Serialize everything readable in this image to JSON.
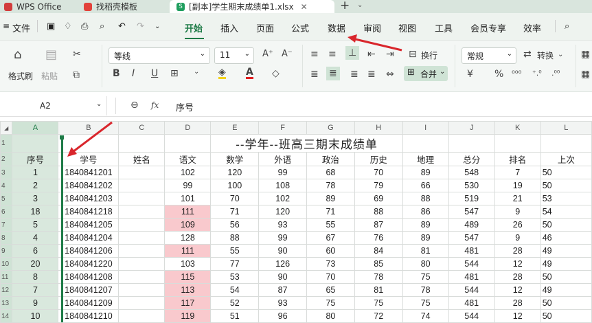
{
  "tabs": [
    {
      "label": "WPS Office",
      "color": "#d23c3c"
    },
    {
      "label": "找稻壳模板",
      "color": "#e2423b"
    },
    {
      "label": "[副本]学生期末成绩单1.xlsx",
      "color": "#1e9e5e",
      "icon_text": "S"
    }
  ],
  "tabbar": {
    "plus": "+",
    "chev": "⌄"
  },
  "menu": {
    "file": "文件",
    "items": [
      "开始",
      "插入",
      "页面",
      "公式",
      "数据",
      "审阅",
      "视图",
      "工具",
      "会员专享",
      "效率"
    ],
    "active": "开始"
  },
  "ribbon": {
    "format_painter": "格式刷",
    "paste": "粘贴",
    "font_name": "等线",
    "font_size": "11",
    "wrap": "换行",
    "merge": "合并",
    "number_format": "常规",
    "convert": "转换",
    "bold": "B",
    "italic": "I",
    "underline": "U",
    "font_color_letter": "A"
  },
  "formula_bar": {
    "cell_ref": "A2",
    "fx": "fx",
    "value": "序号"
  },
  "sheet": {
    "col_headers": [
      "A",
      "B",
      "C",
      "D",
      "E",
      "F",
      "G",
      "H",
      "I",
      "J",
      "K",
      "L"
    ],
    "title": "--学年--班高三期末成绩单",
    "headers": [
      "序号",
      "学号",
      "姓名",
      "语文",
      "数学",
      "外语",
      "政治",
      "历史",
      "地理",
      "总分",
      "排名",
      "上次"
    ],
    "rows": [
      [
        "1",
        "1840841201",
        "",
        "102",
        "120",
        "99",
        "68",
        "70",
        "89",
        "548",
        "7",
        "50"
      ],
      [
        "2",
        "1840841202",
        "",
        "99",
        "100",
        "108",
        "78",
        "79",
        "66",
        "530",
        "19",
        "50"
      ],
      [
        "3",
        "1840841203",
        "",
        "101",
        "70",
        "102",
        "89",
        "69",
        "88",
        "519",
        "21",
        "53"
      ],
      [
        "18",
        "1840841218",
        "",
        "111",
        "71",
        "120",
        "71",
        "88",
        "86",
        "547",
        "9",
        "54"
      ],
      [
        "5",
        "1840841205",
        "",
        "109",
        "56",
        "93",
        "55",
        "87",
        "89",
        "489",
        "26",
        "50"
      ],
      [
        "4",
        "1840841204",
        "",
        "128",
        "88",
        "99",
        "67",
        "76",
        "89",
        "547",
        "9",
        "46"
      ],
      [
        "6",
        "1840841206",
        "",
        "111",
        "55",
        "90",
        "60",
        "84",
        "81",
        "481",
        "28",
        "49"
      ],
      [
        "20",
        "1840841220",
        "",
        "103",
        "77",
        "126",
        "73",
        "85",
        "80",
        "544",
        "12",
        "49"
      ],
      [
        "8",
        "1840841208",
        "",
        "115",
        "53",
        "90",
        "70",
        "78",
        "75",
        "481",
        "28",
        "50"
      ],
      [
        "7",
        "1840841207",
        "",
        "113",
        "54",
        "87",
        "65",
        "81",
        "78",
        "544",
        "12",
        "49"
      ],
      [
        "9",
        "1840841209",
        "",
        "117",
        "52",
        "93",
        "75",
        "75",
        "75",
        "481",
        "28",
        "50"
      ],
      [
        "10",
        "1840841210",
        "",
        "119",
        "51",
        "96",
        "80",
        "72",
        "74",
        "544",
        "12",
        "50"
      ]
    ],
    "highlight_rows": [
      3,
      4,
      6,
      8,
      9,
      10,
      11
    ],
    "highlight_color": "#f9c9cd",
    "row_numbers": [
      "1",
      "2",
      "3",
      "4",
      "5",
      "6",
      "7",
      "8",
      "9",
      "10",
      "11",
      "12",
      "13",
      "14"
    ]
  },
  "colors": {
    "accent": "#1e7b47",
    "arrow": "#d9262c"
  }
}
